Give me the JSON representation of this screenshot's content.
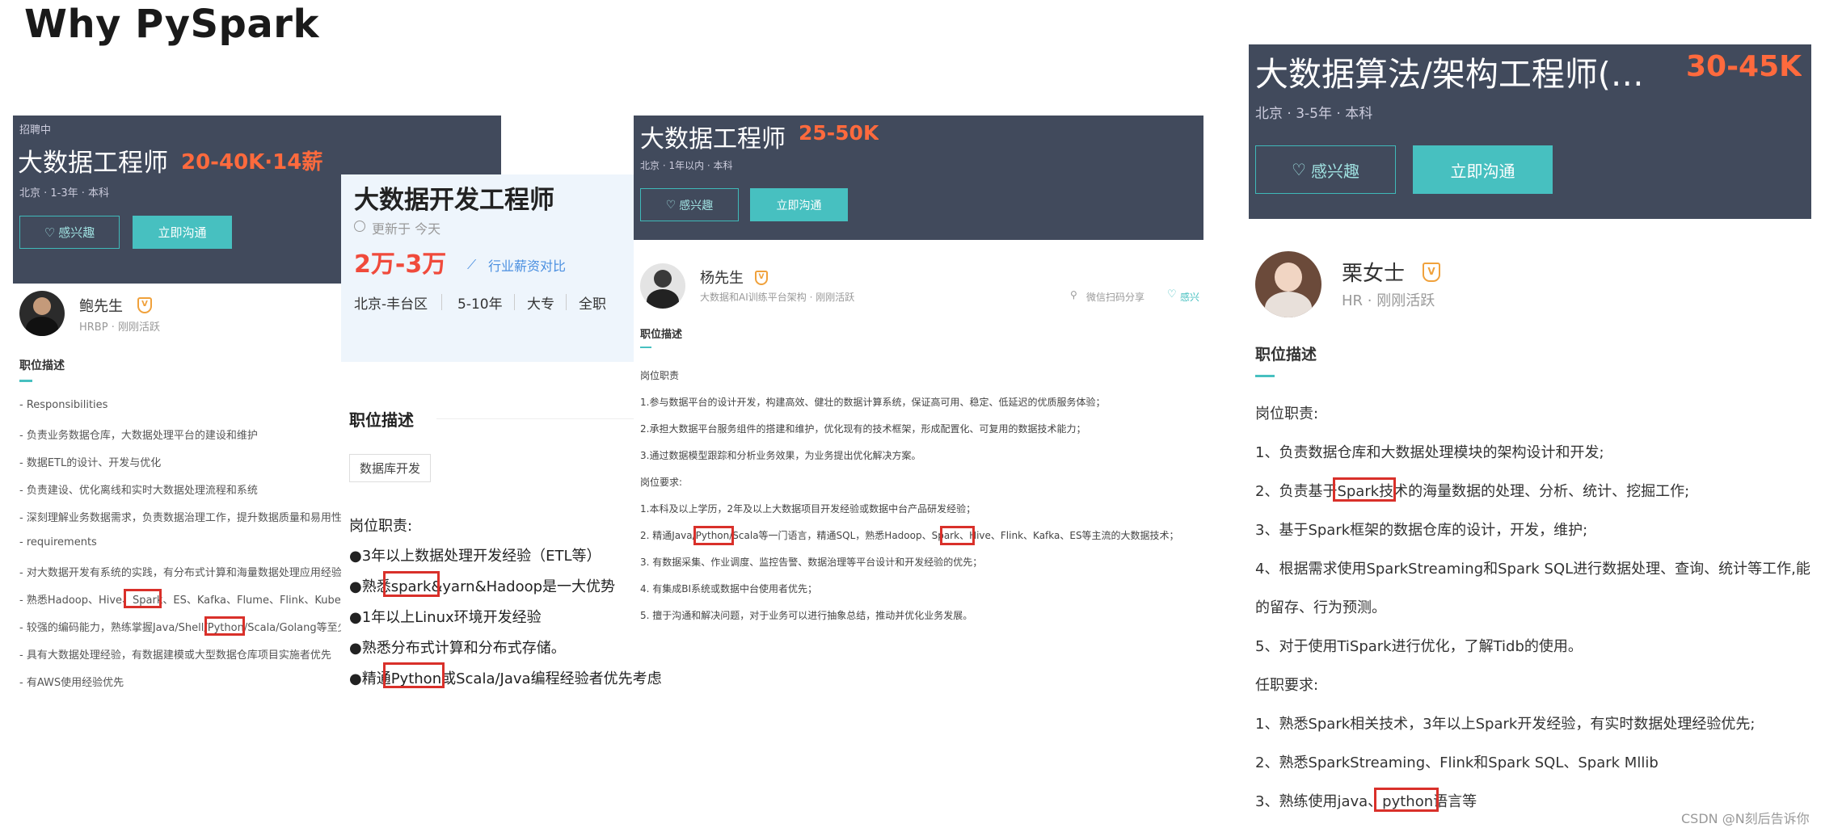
{
  "page": {
    "title": "Why PySpark",
    "watermark": "CSDN @N刻后告诉你"
  },
  "colors": {
    "header_bg": "#414a5c",
    "salary": "#ff6a3d",
    "accent": "#47c0c0",
    "highlight_box": "#d9302a"
  },
  "card1": {
    "status": "招聘中",
    "job_title": "大数据工程师",
    "salary": "20-40K·14薪",
    "meta": "北京 · 1-3年 · 本科",
    "interest_btn": "感兴趣",
    "chat_btn": "立即沟通",
    "recruiter_name": "鲍先生",
    "recruiter_meta": "HRBP · 刚刚活跃",
    "section_title": "职位描述",
    "lines": [
      "- Responsibilities",
      "- 负责业务数据仓库，大数据处理平台的建设和维护",
      "- 数据ETL的设计、开发与优化",
      "- 负责建设、优化离线和实时大数据处理流程和系统",
      "- 深刻理解业务数据需求，负责数据治理工作，提升数据质量和易用性",
      "- requirements",
      "- 对大数据开发有系统的实践，有分布式计算和海量数据处理应用经验",
      "- 熟悉Hadoop、Hive、Spark、ES、Kafka、Flume、Flink、Kubernetes",
      "- 较强的编码能力，熟练掌握Java/Shell/Python/Scala/Golang等至少一种",
      "- 具有大数据处理经验，有数据建模或大型数据仓库项目实施者优先",
      "- 有AWS使用经验优先"
    ]
  },
  "card2": {
    "job_title": "大数据开发工程师",
    "updated": "更新于 今天",
    "salary": "2万-3万",
    "compare_link": "行业薪资对比",
    "tags": [
      "北京-丰台区",
      "5-10年",
      "大专",
      "全职"
    ],
    "section_title": "职位描述",
    "category_tag": "数据库开发",
    "duty_title": "岗位职责:",
    "lines": [
      "●3年以上数据处理开发经验（ETL等）",
      "●熟悉spark&yarn&Hadoop是一大优势",
      "●1年以上Linux环境开发经验",
      "●熟悉分布式计算和分布式存储。",
      "●精通Python或Scala/Java编程经验者优先考虑"
    ]
  },
  "card3": {
    "job_title": "大数据工程师",
    "salary": "25-50K",
    "meta": "北京 · 1年以内 · 本科",
    "interest_btn": "感兴趣",
    "chat_btn": "立即沟通",
    "recruiter_name": "杨先生",
    "recruiter_meta": "大数据和AI训练平台架构 · 刚刚活跃",
    "share_text": "微信扫码分享",
    "like_text": "感兴",
    "section_title": "职位描述",
    "lines": [
      "岗位职责",
      "1.参与数据平台的设计开发，构建高效、健壮的数据计算系统，保证高可用、稳定、低延迟的优质服务体验；",
      "2.承担大数据平台服务组件的搭建和维护，优化现有的技术框架，形成配置化、可复用的数据技术能力；",
      "3.通过数据模型跟踪和分析业务效果，为业务提出优化解决方案。",
      "岗位要求:",
      "1.本科及以上学历，2年及以上大数据项目开发经验或数据中台产品研发经验；",
      "2. 精通Java/Python/Scala等一门语言，精通SQL，熟悉Hadoop、Spark、Hive、Flink、Kafka、ES等主流的大数据技术；",
      "3. 有数据采集、作业调度、监控告警、数据治理等平台设计和开发经验的优先；",
      "4. 有集成BI系统或数据中台使用者优先；",
      "5. 擅于沟通和解决问题，对于业务可以进行抽象总结，推动并优化业务发展。"
    ]
  },
  "card4": {
    "job_title": "大数据算法/架构工程师(…",
    "salary": "30-45K",
    "meta": "北京 · 3-5年 · 本科",
    "interest_btn": "感兴趣",
    "chat_btn": "立即沟通",
    "recruiter_name": "栗女士",
    "recruiter_meta": "HR · 刚刚活跃",
    "section_title": "职位描述",
    "lines": [
      "岗位职责:",
      "1、负责数据仓库和大数据处理模块的架构设计和开发;",
      "2、负责基于Spark技术的海量数据的处理、分析、统计、挖掘工作;",
      "3、基于Spark框架的数据仓库的设计，开发，维护;",
      "4、根据需求使用SparkStreaming和Spark SQL进行数据处理、查询、统计等工作,能",
      "的留存、行为预测。",
      "5、对于使用TiSpark进行优化，了解Tidb的使用。",
      "任职要求:",
      "1、熟悉Spark相关技术，3年以上Spark开发经验，有实时数据处理经验优先;",
      "2、熟悉SparkStreaming、Flink和Spark SQL、Spark Mllib",
      "3、熟练使用java、python语言等"
    ]
  }
}
